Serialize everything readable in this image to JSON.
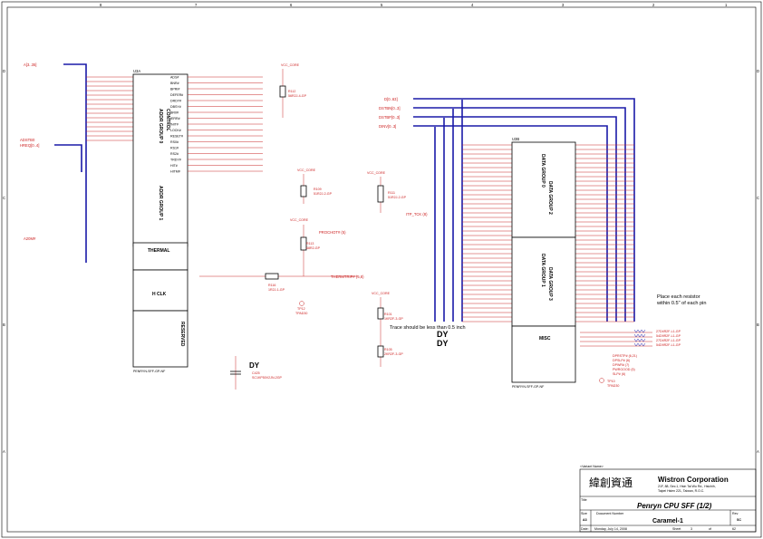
{
  "header_signals": {
    "a_bus": "A[3..35]",
    "adstb": "ADSTB0",
    "hreq": "HREQ[0..4]",
    "a20m": "A20M#",
    "reset": "RESET#",
    "d_bus": "D[0..63]",
    "dstbn": "DSTBN[0..3]",
    "dstbp": "DSTBP[0..3]",
    "dinv": "DINV[0..3]"
  },
  "u_top": {
    "ref": "U3A",
    "part": "PENRYN-SFF-GP-NF",
    "block_addr0": "ADDR GROUP 0",
    "block_ctrl": "CONTROL",
    "block_addr1": "ADDR GROUP 1",
    "block_thermal": "THERMAL",
    "block_hclk": "H CLK",
    "block_reserved": "RESERVED",
    "left_pins": [
      "A3#",
      "A4#",
      "A5#",
      "A6#",
      "A7#",
      "A8#",
      "A9#",
      "A10#",
      "A11#",
      "A12#",
      "A13#",
      "A14#",
      "A15#",
      "A16#",
      "ADSTB0#"
    ],
    "right_pins": [
      "ADS#",
      "BNR#",
      "BPRI#",
      "DEFER#",
      "DRDY#",
      "DBSY#",
      "BR0#",
      "IERR#",
      "INIT#",
      "LOCK#",
      "RESET#",
      "RS0#",
      "RS1#",
      "RS2#",
      "TRDY#",
      "HIT#",
      "HITM#"
    ]
  },
  "u_bottom": {
    "ref": "U3B",
    "part": "PENRYN-SFF-GP-NF",
    "block_data0": "DATA GROUP 0",
    "block_data2": "DATA GROUP 2",
    "block_data1": "DATA GROUP 1",
    "block_data3": "DATA GROUP 3",
    "block_misc": "MISC"
  },
  "components": {
    "r_vcc_top": "VCC_CORE",
    "r112": "R112",
    "r112_val": "56R2J-4-GP",
    "r109": "R109",
    "r109_val": "51R2J-2-GP",
    "r111": "R111",
    "r111_val": "51R2J-2-GP",
    "r113": "R113",
    "r113_val": "68R2-GP",
    "r116": "R116",
    "r116_val": "1R2J-1-GP",
    "r101": "R101",
    "r101_val": "1KR2F-3-GP",
    "r105": "R105",
    "r105_val": "2KR2F-3-GP",
    "c425": "C425",
    "c425_val": "SC1KP50V2JN-2GP",
    "dy": "DY",
    "tp12": "TP12",
    "tpad": "TPAD30",
    "tp10": "TP10"
  },
  "notes": {
    "trace_note": "Trace should be less than 0.5 inch",
    "resistor_note_1": "Place each resistor",
    "resistor_note_2": "within 0.5\" of each pin"
  },
  "misc_right_labels": {
    "prochot": "PROCHOT# (5)",
    "thermtrip": "THERMTRIP# (5,8)",
    "itp": "ITP_TCK (8)",
    "comp_parts": [
      "27D4R2F-L1-GP",
      "54D9R2F-L1-GP",
      "27D4R2F-L1-GP",
      "54D9R2F-L1-GP"
    ],
    "cpu_labels": [
      "DPRSTP# (6,21)",
      "DPSLP# (6)",
      "DPWR# (7)",
      "PWRGOOD (5)",
      "SLP# (6)"
    ]
  },
  "title_block": {
    "vendor_name": "<Variant Name>",
    "company": "Wistron Corporation",
    "address1": "21F, 88, Sec.1, Hsin Tai Wu Rd., Hsichih,",
    "address2": "Taipei Hsien 221, Taiwan, R.O.C.",
    "logo_text": "緯創資通",
    "title_label": "Title",
    "title": "Penryn CPU SFF (1/2)",
    "size_label": "Size",
    "size": "A3",
    "docnum_label": "Document Number",
    "docnum": "Caramel-1",
    "rev_label": "Rev",
    "rev": "SC",
    "date_label": "Date:",
    "date": "Monday, July 14, 2008",
    "sheet_label": "Sheet",
    "sheet": "3",
    "of_label": "of",
    "total": "62"
  },
  "border": {
    "cols": [
      "8",
      "7",
      "6",
      "5",
      "4",
      "3",
      "2",
      "1"
    ],
    "rows": [
      "D",
      "C",
      "B",
      "A"
    ]
  }
}
